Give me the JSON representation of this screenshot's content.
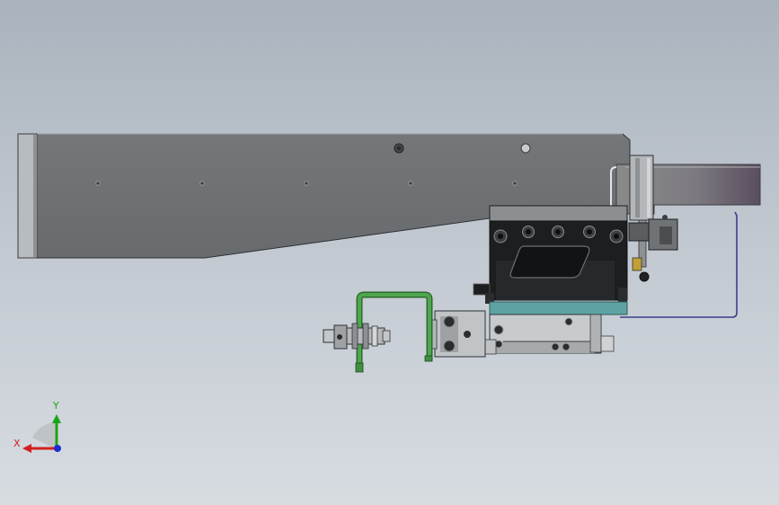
{
  "viewport": {
    "colors": {
      "background_top": "#aab3bd",
      "background_bottom": "#d7dce1",
      "plate": "#6f7275",
      "block": "#1c1e20",
      "teal": "#5ea3a3",
      "green": "#3f8f3f",
      "cable": "#3a3f8c"
    }
  },
  "triad": {
    "x_label": "X",
    "y_label": "Y",
    "colors": {
      "x": "#d21f1f",
      "y": "#1aa31a",
      "z": "#1a2fd2"
    }
  }
}
